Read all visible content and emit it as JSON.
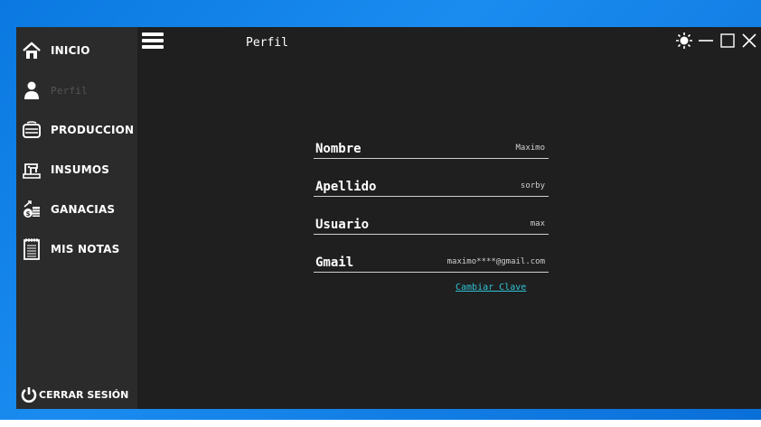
{
  "topbar": {
    "title": "Perfil",
    "menu_icon": "hamburger-icon",
    "controls": [
      "brightness-icon",
      "minimize-icon",
      "maximize-icon",
      "close-icon"
    ]
  },
  "sidebar": {
    "items": [
      {
        "label": "INICIO",
        "icon": "home-icon",
        "enabled": true
      },
      {
        "label": "Perfil",
        "icon": "user-icon",
        "enabled": false
      },
      {
        "label": "PRODUCCION",
        "icon": "production-icon",
        "enabled": true
      },
      {
        "label": "INSUMOS",
        "icon": "sewing-machine-icon",
        "enabled": true
      },
      {
        "label": "GANACIAS",
        "icon": "money-icon",
        "enabled": true
      },
      {
        "label": "MIS NOTAS",
        "icon": "notepad-icon",
        "enabled": true
      }
    ],
    "logout_label": "CERRAR SESIÓN"
  },
  "profile": {
    "fields": [
      {
        "label": "Nombre",
        "value": "Maximo"
      },
      {
        "label": "Apellido",
        "value": "sorby"
      },
      {
        "label": "Usuario",
        "value": "max"
      },
      {
        "label": "Gmail",
        "value": "maximo****@gmail.com"
      }
    ],
    "change_password_label": "Cambiar Clave"
  },
  "colors": {
    "background": "#1f1f1f",
    "sidebar": "#2b2b2b",
    "link": "#2ec4d6",
    "desktop": "#0a78e0"
  }
}
